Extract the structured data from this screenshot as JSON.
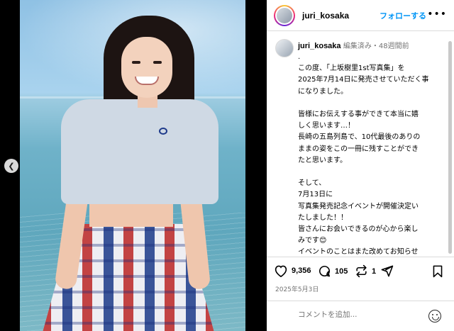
{
  "post": {
    "username": "juri_kosaka",
    "follow_label": "フォローする",
    "more_label": "•••"
  },
  "caption": {
    "username": "juri_kosaka",
    "meta": "編集済み・48週間前",
    "body": ".\nこの度、「上坂樹里1st写真集」を\n2025年7月14日に発売させていただく事\nになりました。\n\n皆様にお伝えする事ができて本当に嬉\nしく思います…！\n長崎の五島列島で、10代最後のありの\nままの姿をこの一冊に残すことができ\nたと思います。\n\nそして、\n7月13日に\n写真集発売記念イベントが開催決定い\nたしました！！\n皆さんにお会いできるのが心から楽し\nみです😊\nイベントのことはまた改めてお知らせ\nします\n\nそしてそして、"
  },
  "stats": {
    "likes": "9,356",
    "comments": "105",
    "reposts": "1",
    "date": "2025年5月3日"
  },
  "comment": {
    "placeholder": "コメントを追加..."
  },
  "icons": {
    "like": "heart-icon",
    "comment": "comment-bubble-icon",
    "repost": "repost-icon",
    "share": "send-icon",
    "save": "bookmark-icon",
    "emoji": "emoji-icon",
    "prev": "chevron-left-icon"
  },
  "colors": {
    "follow": "#0095f6",
    "meta_gray": "#737373",
    "divider": "#dbdbdb"
  }
}
